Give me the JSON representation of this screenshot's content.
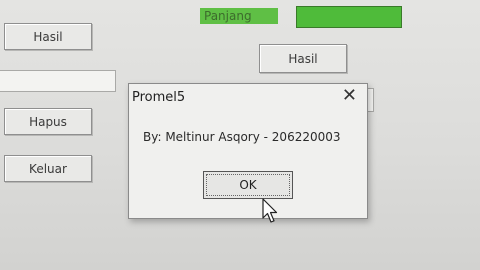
{
  "form": {
    "hasil_button_1": "Hasil",
    "hapus_button": "Hapus",
    "keluar_button": "Keluar",
    "panjang_label": "Panjang",
    "hasil_button_2": "Hasil"
  },
  "dialog": {
    "title": "Promel5",
    "close_glyph": "✕",
    "message": "By: Meltinur Asqory - 206220003",
    "ok_label": "OK"
  },
  "colors": {
    "highlight_green": "#4fbb3a"
  },
  "icons": {
    "cursor": "mouse-pointer-icon"
  }
}
